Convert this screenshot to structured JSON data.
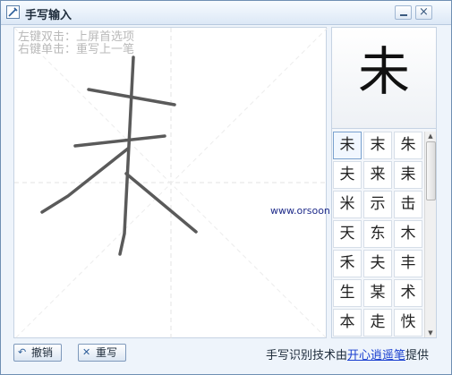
{
  "window": {
    "title": "手写输入",
    "minimize_label": "-",
    "close_label": "×"
  },
  "canvas": {
    "hint_line1": "左键双击：上屏首选项",
    "hint_line2": "右键单击：重写上一笔",
    "watermark": "www.orsoon.com"
  },
  "preview": {
    "char": "未"
  },
  "candidates": [
    "未",
    "末",
    "朱",
    "夫",
    "来",
    "耒",
    "米",
    "示",
    "击",
    "天",
    "东",
    "木",
    "禾",
    "夫",
    "丰",
    "生",
    "某",
    "术",
    "本",
    "走",
    "怢"
  ],
  "scrollbar": {
    "up_icon": "▲",
    "down_icon": "▼"
  },
  "bottombar": {
    "undo_label": "撤销",
    "rewrite_label": "重写",
    "footer_prefix": "手写识别技术由",
    "footer_link": "开心逍遥笔",
    "footer_suffix": "提供"
  },
  "colors": {
    "accent": "#1a3fd0",
    "stroke": "#555555",
    "window_border": "#6f8fb3"
  }
}
